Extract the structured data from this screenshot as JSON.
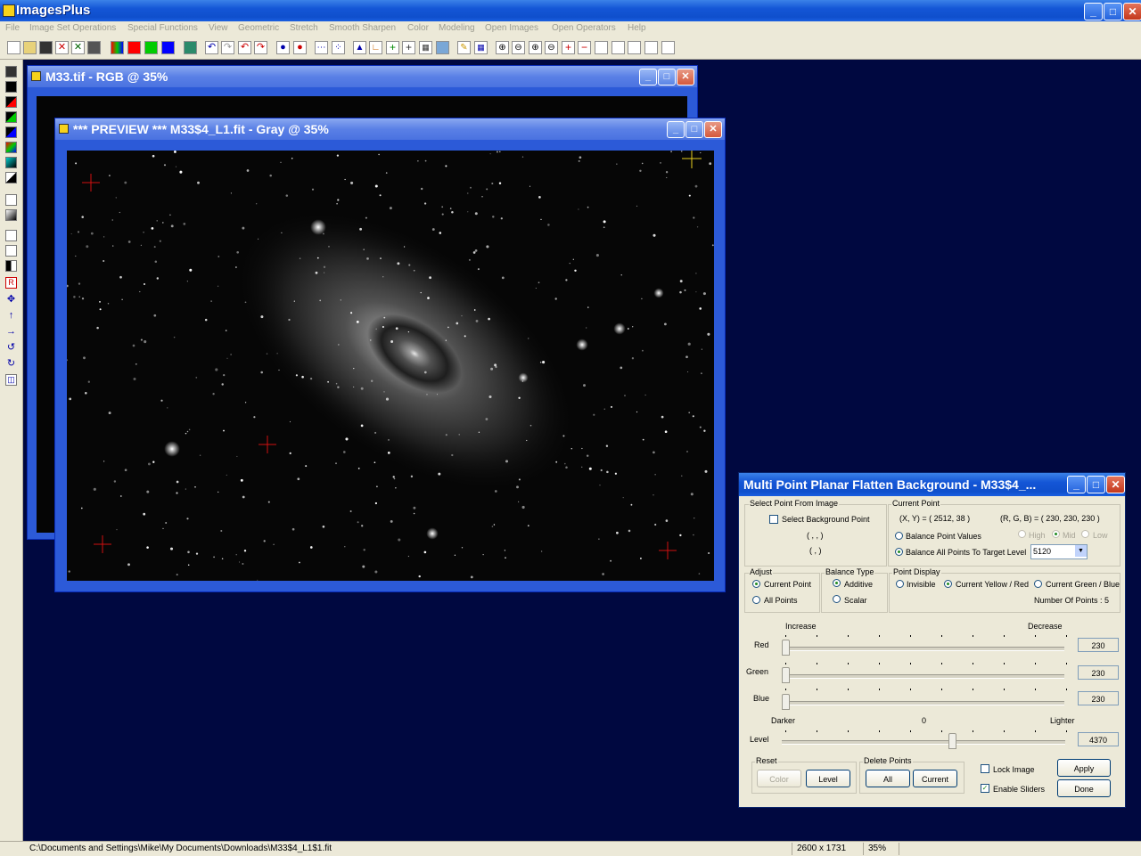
{
  "app": {
    "title": "ImagesPlus"
  },
  "menu": [
    "File",
    "Image Set Operations",
    "Special Functions",
    "View",
    "Geometric",
    "Stretch",
    "Smooth Sharpen",
    "Color",
    "Modeling",
    "Open Images",
    "Open Operators",
    "Help"
  ],
  "window_back": {
    "title": "M33.tif - RGB @ 35%"
  },
  "window_front": {
    "title": "*** PREVIEW *** M33$4_L1.fit - Gray @ 35%"
  },
  "dialog": {
    "title": "Multi Point Planar Flatten Background - M33$4_...",
    "select_group": "Select Point From Image",
    "select_bg_point": "Select Background Point",
    "coord_line1": "( , , )",
    "coord_line2": "( , )",
    "current_point_group": "Current Point",
    "xy_readout": "(X, Y) = ( 2512, 38 )",
    "rgb_readout": "(R, G, B) = ( 230, 230, 230 )",
    "balance_point_values": "Balance Point Values",
    "high": "High",
    "mid": "Mid",
    "low": "Low",
    "balance_all": "Balance All Points To Target Level",
    "target_level": "5120",
    "adjust_group": "Adjust",
    "adjust_current": "Current Point",
    "adjust_all": "All Points",
    "balance_type_group": "Balance Type",
    "additive": "Additive",
    "scalar": "Scalar",
    "point_display_group": "Point Display",
    "invisible": "Invisible",
    "yellow_red": "Current Yellow / Red",
    "green_blue": "Current Green / Blue",
    "num_points": "Number Of Points : 5",
    "increase": "Increase",
    "decrease": "Decrease",
    "red_label": "Red",
    "green_label": "Green",
    "blue_label": "Blue",
    "red_value": "230",
    "green_value": "230",
    "blue_value": "230",
    "darker": "Darker",
    "zero": "0",
    "lighter": "Lighter",
    "level_label": "Level",
    "level_value": "4370",
    "reset_group": "Reset",
    "reset_color": "Color",
    "reset_level": "Level",
    "delete_group": "Delete Points",
    "delete_all": "All",
    "delete_current": "Current",
    "lock_image": "Lock Image",
    "enable_sliders": "Enable Sliders",
    "apply": "Apply",
    "done": "Done",
    "level_slider_fraction": 0.6
  },
  "status": {
    "path": "C:\\Documents and Settings\\Mike\\My Documents\\Downloads\\M33$4_L1$1.fit",
    "dims": "2600 x 1731",
    "zoom": "35%"
  }
}
